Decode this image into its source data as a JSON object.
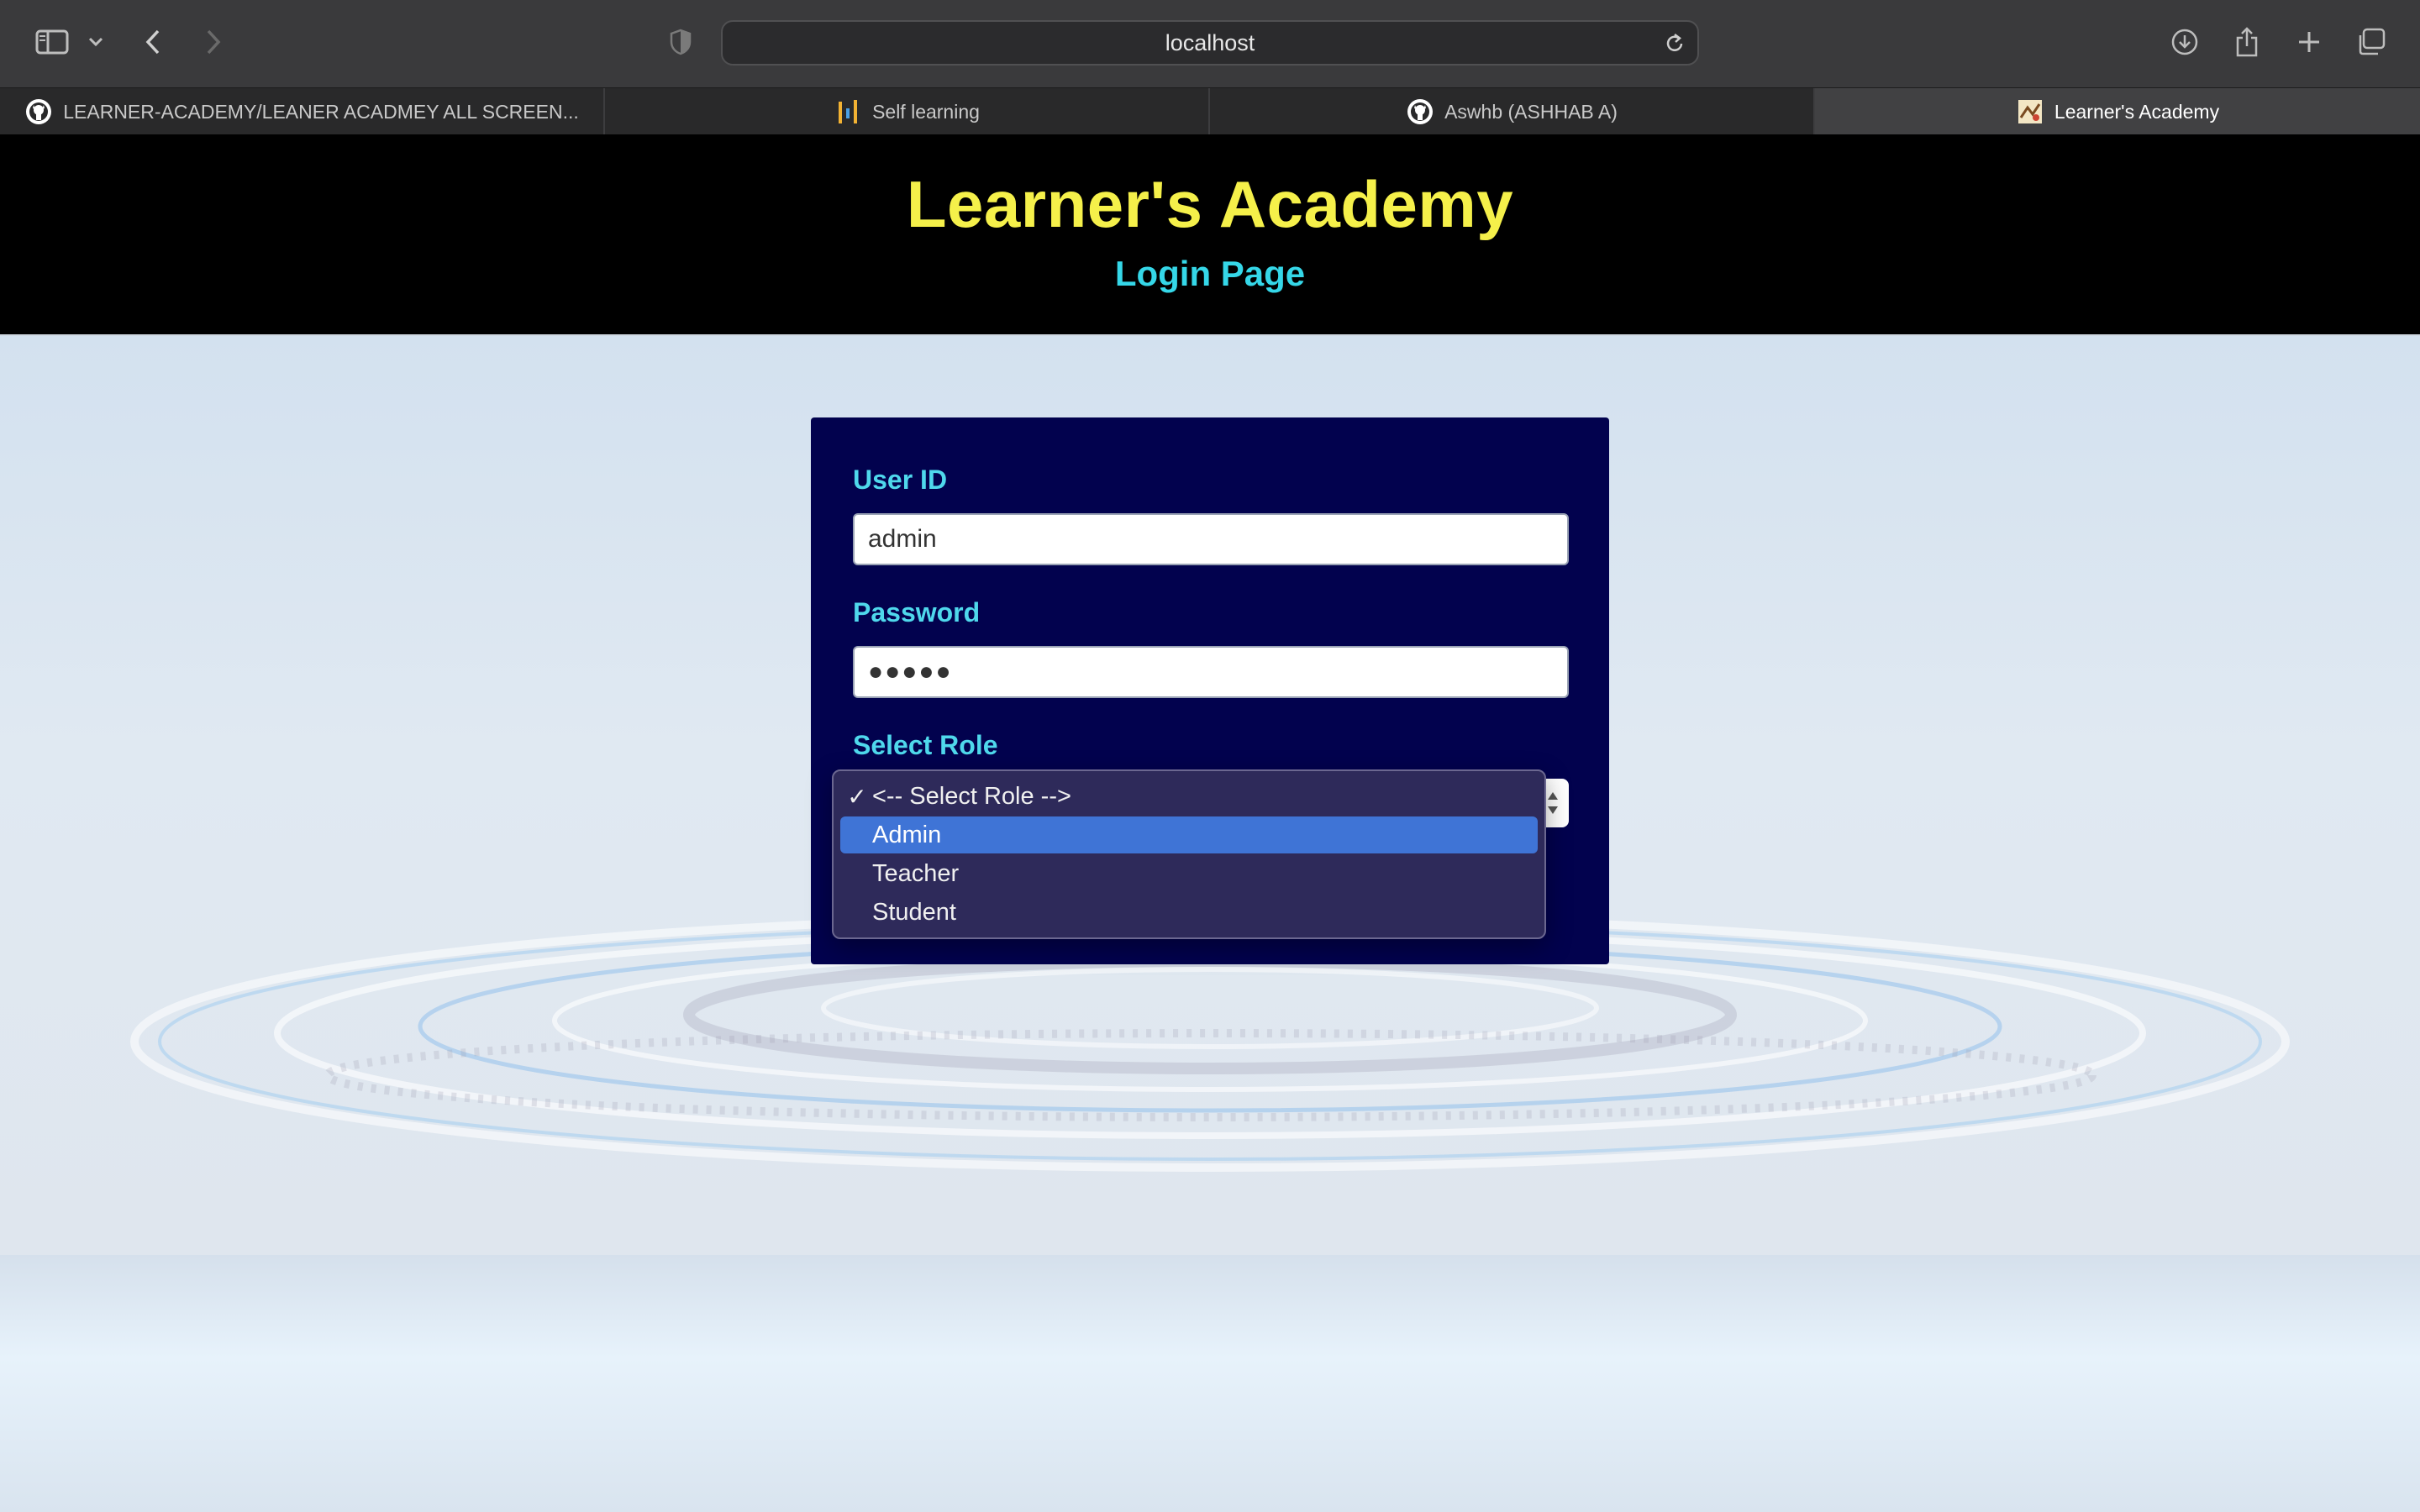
{
  "browser": {
    "address": "localhost",
    "tabs": [
      {
        "label": "LEARNER-ACADEMY/LEANER ACADMEY ALL SCREEN...",
        "icon": "github-icon"
      },
      {
        "label": "Self learning",
        "icon": "bar-chart-icon"
      },
      {
        "label": "Aswhb (ASHHAB A)",
        "icon": "github-icon"
      },
      {
        "label": "Learner's Academy",
        "icon": "site-favicon",
        "active": true
      }
    ]
  },
  "header": {
    "title": "Learner's Academy",
    "subtitle": "Login Page"
  },
  "form": {
    "user_id_label": "User ID",
    "user_id_value": "admin",
    "password_label": "Password",
    "password_value": "●●●●●",
    "role_label": "Select Role",
    "role_options": [
      {
        "label": "<-- Select Role -->",
        "checked": true
      },
      {
        "label": "Admin",
        "highlighted": true
      },
      {
        "label": "Teacher"
      },
      {
        "label": "Student"
      }
    ]
  },
  "colors": {
    "title": "#f5f04a",
    "subtitle": "#35d7e8",
    "card": "#02024e",
    "label": "#4fd8ec",
    "highlight": "#3f74d6"
  }
}
